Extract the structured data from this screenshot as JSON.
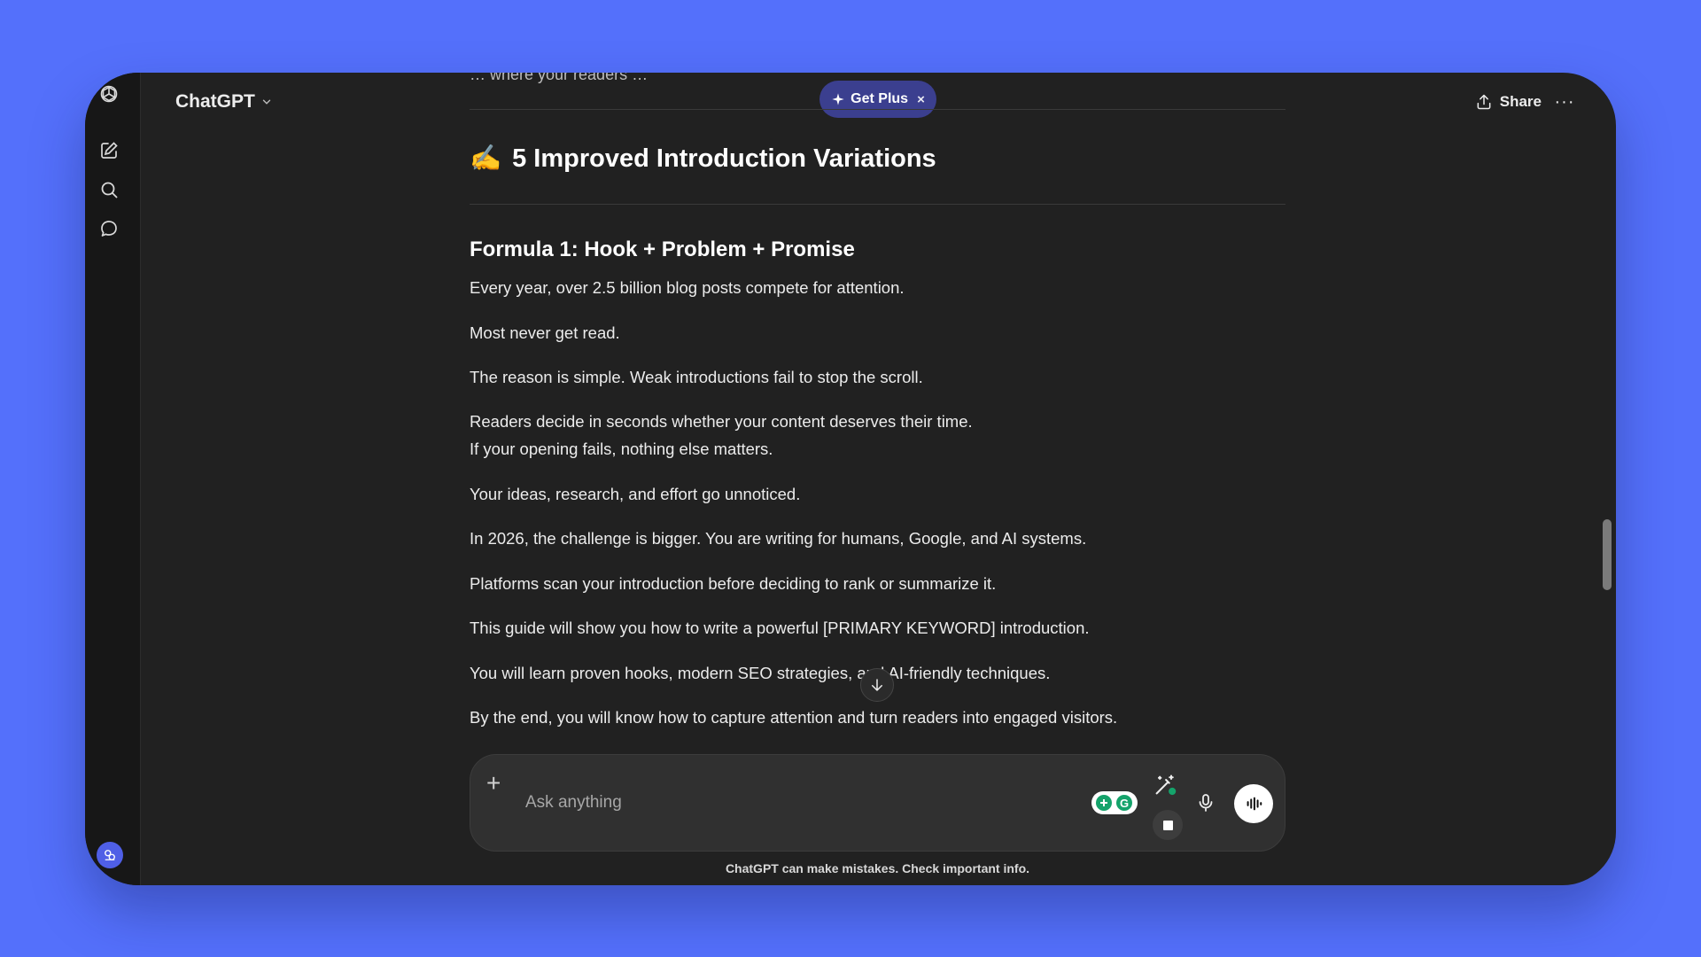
{
  "header": {
    "app_name": "ChatGPT",
    "get_plus_label": "Get Plus",
    "get_plus_close": "×",
    "share_label": "Share",
    "more_label": "···"
  },
  "sidebar": {
    "icons": [
      "openai-logo-icon",
      "new-chat-icon",
      "search-icon",
      "chat-bubble-icon",
      "avatar"
    ]
  },
  "conversation": {
    "cut_text": "… where your readers …",
    "heading_emoji": "✍️",
    "heading": "5 Improved Introduction Variations",
    "subheading": "Formula 1: Hook + Problem + Promise",
    "paragraphs": [
      "Every year, over 2.5 billion blog posts compete for attention.",
      "Most never get read.",
      "The reason is simple. Weak introductions fail to stop the scroll.",
      "Readers decide in seconds whether your content deserves their time.",
      "If your opening fails, nothing else matters.",
      "Your ideas, research, and effort go unnoticed.",
      "In 2026, the challenge is bigger. You are writing for humans, Google, and AI systems.",
      "Platforms scan your introduction before deciding to rank or summarize it.",
      "This guide will show you how to write a powerful [PRIMARY KEYWORD] introduction.",
      "You will learn proven hooks, modern SEO strategies, and AI-friendly techniques.",
      "By the end, you will know how to capture attention and turn readers into engaged visitors."
    ]
  },
  "composer": {
    "placeholder": "Ask anything",
    "plus_label": "+"
  },
  "footer": {
    "note": "ChatGPT can make mistakes. Check important info."
  },
  "colors": {
    "page_background": "#5470fb",
    "window_background": "#212121",
    "sidebar_background": "#171717",
    "accent_plus": "#3b3f8f",
    "text_primary": "#ececec"
  }
}
